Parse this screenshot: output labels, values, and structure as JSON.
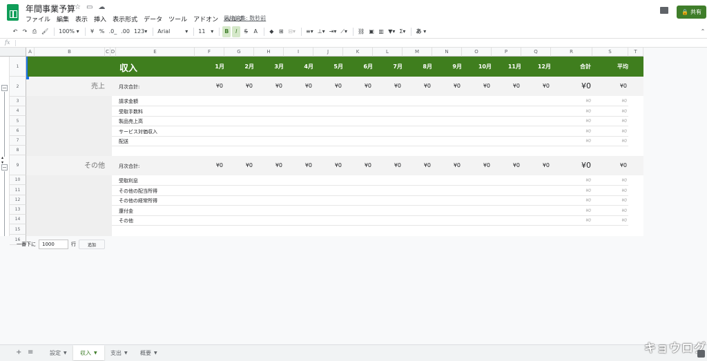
{
  "app": {
    "doc_title": "年間事業予算",
    "menu": [
      "ファイル",
      "編集",
      "表示",
      "挿入",
      "表示形式",
      "データ",
      "ツール",
      "アドオン",
      "ヘルプ"
    ],
    "last_edit": "最終編集: 数秒前",
    "share_label": "共有",
    "accent_color": "#3f7e2a"
  },
  "toolbar": {
    "zoom": "100%",
    "currency": "¥",
    "percent": "%",
    "decimal_dec": ".0_",
    "decimal_inc": ".00",
    "format_more": "123",
    "font": "Arial",
    "font_size": "11",
    "bold": "B",
    "italic": "I",
    "strike": "S",
    "text_color": "A",
    "sum": "Σ",
    "input_tool": "あ"
  },
  "formula_bar": {
    "fx": "fx"
  },
  "columns": [
    "A",
    "B",
    "C",
    "D",
    "E",
    "F",
    "G",
    "H",
    "I",
    "J",
    "K",
    "L",
    "M",
    "N",
    "O",
    "P",
    "Q",
    "R",
    "S",
    "T"
  ],
  "rows": [
    "1",
    "2",
    "3",
    "4",
    "5",
    "6",
    "7",
    "8",
    "9",
    "10",
    "11",
    "12",
    "13",
    "14",
    "15",
    "16"
  ],
  "header": {
    "title": "収入",
    "months": [
      "1月",
      "2月",
      "3月",
      "4月",
      "5月",
      "6月",
      "7月",
      "8月",
      "9月",
      "10月",
      "11月",
      "12月"
    ],
    "total": "合計",
    "average": "平均"
  },
  "sections": [
    {
      "name": "売上",
      "subtotal_label": "月次合計:",
      "subtotal_values": [
        "¥0",
        "¥0",
        "¥0",
        "¥0",
        "¥0",
        "¥0",
        "¥0",
        "¥0",
        "¥0",
        "¥0",
        "¥0",
        "¥0"
      ],
      "subtotal_total": "¥0",
      "subtotal_avg": "¥0",
      "items": [
        {
          "label": "請求金額",
          "total": "¥0",
          "avg": "¥0"
        },
        {
          "label": "受取手数料",
          "total": "¥0",
          "avg": "¥0"
        },
        {
          "label": "製品売上高",
          "total": "¥0",
          "avg": "¥0"
        },
        {
          "label": "サービス対価収入",
          "total": "¥0",
          "avg": "¥0"
        },
        {
          "label": "配送",
          "total": "¥0",
          "avg": "¥0"
        }
      ]
    },
    {
      "name": "その他",
      "subtotal_label": "月次合計:",
      "subtotal_values": [
        "¥0",
        "¥0",
        "¥0",
        "¥0",
        "¥0",
        "¥0",
        "¥0",
        "¥0",
        "¥0",
        "¥0",
        "¥0",
        "¥0"
      ],
      "subtotal_total": "¥0",
      "subtotal_avg": "¥0",
      "items": [
        {
          "label": "受取利息",
          "total": "¥0",
          "avg": "¥0"
        },
        {
          "label": "その他の配当所得",
          "total": "¥0",
          "avg": "¥0"
        },
        {
          "label": "その他の経常所得",
          "total": "¥0",
          "avg": "¥0"
        },
        {
          "label": "還付金",
          "total": "¥0",
          "avg": "¥0"
        },
        {
          "label": "その他",
          "total": "¥0",
          "avg": "¥0"
        }
      ]
    }
  ],
  "add_rows": {
    "prefix": "一番下に",
    "value": "1000",
    "suffix": "行",
    "button": "追加"
  },
  "tabs": [
    {
      "label": "設定",
      "active": false
    },
    {
      "label": "収入",
      "active": true
    },
    {
      "label": "支出",
      "active": false
    },
    {
      "label": "概要",
      "active": false
    }
  ],
  "watermark": "キョウログ"
}
